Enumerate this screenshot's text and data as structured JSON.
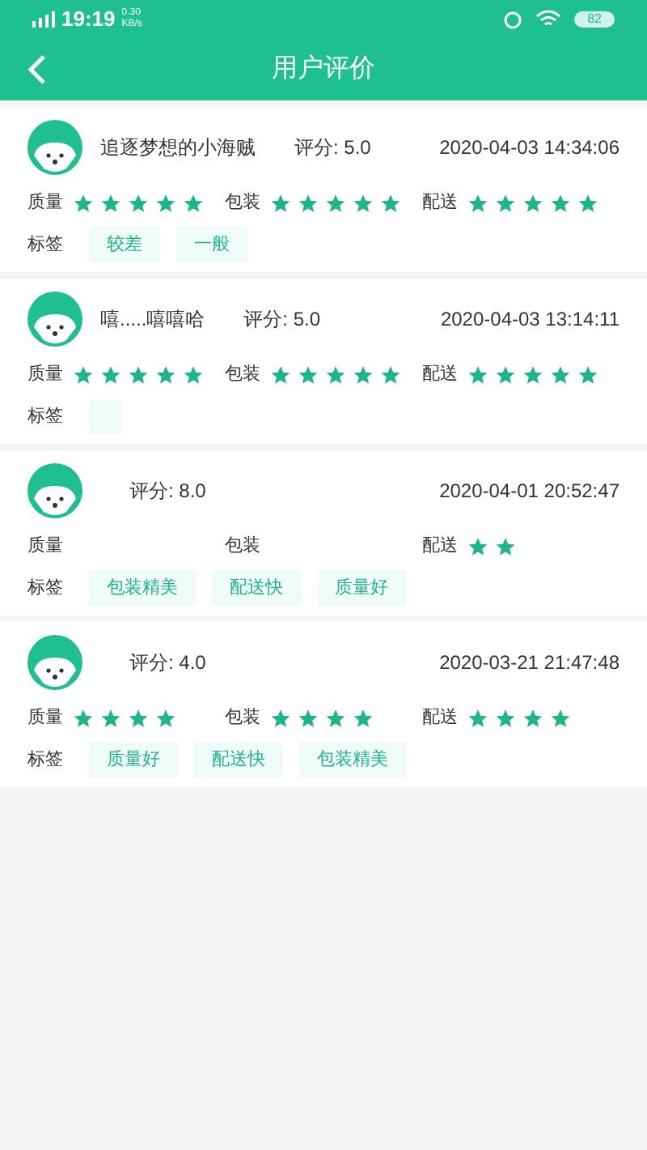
{
  "status_bar": {
    "time": "19:19",
    "speed": "0.30\nKB/s",
    "battery": "82"
  },
  "header": {
    "title": "用户评价"
  },
  "reviews": [
    {
      "name": "追逐梦想的小海贼",
      "score": "评分: 5.0",
      "date": "2020-04-03 14:34:06",
      "ratings": [
        {
          "label": "质量",
          "stars": 5
        },
        {
          "label": "包装",
          "stars": 5
        },
        {
          "label": "配送",
          "stars": 5
        }
      ],
      "tags_label": "标签",
      "tags": [
        "较差",
        "一般"
      ],
      "blank_tag": false
    },
    {
      "name": "嘻.....嘻嘻哈",
      "score": "评分: 5.0",
      "date": "2020-04-03 13:14:11",
      "ratings": [
        {
          "label": "质量",
          "stars": 5
        },
        {
          "label": "包装",
          "stars": 5
        },
        {
          "label": "配送",
          "stars": 5
        }
      ],
      "tags_label": "标签",
      "blank_tag": true
    },
    {
      "score": "评分: 8.0",
      "date": "2020-04-01 20:52:47",
      "ratings": [
        {
          "label": "质量"
        },
        {
          "label": "包装"
        },
        {
          "label": "配送",
          "stars": 2
        }
      ],
      "tags_label": "标签",
      "tags": [
        "包装精美",
        "配送快",
        "质量好"
      ],
      "blank_tag": false
    },
    {
      "score": "评分: 4.0",
      "date": "2020-03-21 21:47:48",
      "ratings": [
        {
          "label": "质量",
          "stars": 4
        },
        {
          "label": "包装",
          "stars": 4
        },
        {
          "label": "配送",
          "stars": 4
        }
      ],
      "tags_label": "标签",
      "tags": [
        "质量好",
        "配送快",
        "包装精美"
      ],
      "blank_tag": false
    }
  ]
}
